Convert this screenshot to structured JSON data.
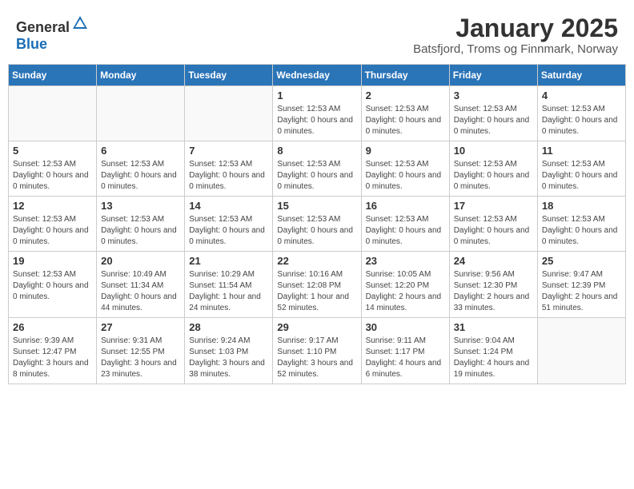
{
  "logo": {
    "general": "General",
    "blue": "Blue"
  },
  "title": "January 2025",
  "location": "Batsfjord, Troms og Finnmark, Norway",
  "headers": [
    "Sunday",
    "Monday",
    "Tuesday",
    "Wednesday",
    "Thursday",
    "Friday",
    "Saturday"
  ],
  "weeks": [
    [
      {
        "day": "",
        "info": ""
      },
      {
        "day": "",
        "info": ""
      },
      {
        "day": "",
        "info": ""
      },
      {
        "day": "1",
        "info": "Sunset: 12:53 AM\nDaylight: 0 hours and 0 minutes."
      },
      {
        "day": "2",
        "info": "Sunset: 12:53 AM\nDaylight: 0 hours and 0 minutes."
      },
      {
        "day": "3",
        "info": "Sunset: 12:53 AM\nDaylight: 0 hours and 0 minutes."
      },
      {
        "day": "4",
        "info": "Sunset: 12:53 AM\nDaylight: 0 hours and 0 minutes."
      }
    ],
    [
      {
        "day": "5",
        "info": "Sunset: 12:53 AM\nDaylight: 0 hours and 0 minutes."
      },
      {
        "day": "6",
        "info": "Sunset: 12:53 AM\nDaylight: 0 hours and 0 minutes."
      },
      {
        "day": "7",
        "info": "Sunset: 12:53 AM\nDaylight: 0 hours and 0 minutes."
      },
      {
        "day": "8",
        "info": "Sunset: 12:53 AM\nDaylight: 0 hours and 0 minutes."
      },
      {
        "day": "9",
        "info": "Sunset: 12:53 AM\nDaylight: 0 hours and 0 minutes."
      },
      {
        "day": "10",
        "info": "Sunset: 12:53 AM\nDaylight: 0 hours and 0 minutes."
      },
      {
        "day": "11",
        "info": "Sunset: 12:53 AM\nDaylight: 0 hours and 0 minutes."
      }
    ],
    [
      {
        "day": "12",
        "info": "Sunset: 12:53 AM\nDaylight: 0 hours and 0 minutes."
      },
      {
        "day": "13",
        "info": "Sunset: 12:53 AM\nDaylight: 0 hours and 0 minutes."
      },
      {
        "day": "14",
        "info": "Sunset: 12:53 AM\nDaylight: 0 hours and 0 minutes."
      },
      {
        "day": "15",
        "info": "Sunset: 12:53 AM\nDaylight: 0 hours and 0 minutes."
      },
      {
        "day": "16",
        "info": "Sunset: 12:53 AM\nDaylight: 0 hours and 0 minutes."
      },
      {
        "day": "17",
        "info": "Sunset: 12:53 AM\nDaylight: 0 hours and 0 minutes."
      },
      {
        "day": "18",
        "info": "Sunset: 12:53 AM\nDaylight: 0 hours and 0 minutes."
      }
    ],
    [
      {
        "day": "19",
        "info": "Sunset: 12:53 AM\nDaylight: 0 hours and 0 minutes."
      },
      {
        "day": "20",
        "info": "Sunrise: 10:49 AM\nSunset: 11:34 AM\nDaylight: 0 hours and 44 minutes."
      },
      {
        "day": "21",
        "info": "Sunrise: 10:29 AM\nSunset: 11:54 AM\nDaylight: 1 hour and 24 minutes."
      },
      {
        "day": "22",
        "info": "Sunrise: 10:16 AM\nSunset: 12:08 PM\nDaylight: 1 hour and 52 minutes."
      },
      {
        "day": "23",
        "info": "Sunrise: 10:05 AM\nSunset: 12:20 PM\nDaylight: 2 hours and 14 minutes."
      },
      {
        "day": "24",
        "info": "Sunrise: 9:56 AM\nSunset: 12:30 PM\nDaylight: 2 hours and 33 minutes."
      },
      {
        "day": "25",
        "info": "Sunrise: 9:47 AM\nSunset: 12:39 PM\nDaylight: 2 hours and 51 minutes."
      }
    ],
    [
      {
        "day": "26",
        "info": "Sunrise: 9:39 AM\nSunset: 12:47 PM\nDaylight: 3 hours and 8 minutes."
      },
      {
        "day": "27",
        "info": "Sunrise: 9:31 AM\nSunset: 12:55 PM\nDaylight: 3 hours and 23 minutes."
      },
      {
        "day": "28",
        "info": "Sunrise: 9:24 AM\nSunset: 1:03 PM\nDaylight: 3 hours and 38 minutes."
      },
      {
        "day": "29",
        "info": "Sunrise: 9:17 AM\nSunset: 1:10 PM\nDaylight: 3 hours and 52 minutes."
      },
      {
        "day": "30",
        "info": "Sunrise: 9:11 AM\nSunset: 1:17 PM\nDaylight: 4 hours and 6 minutes."
      },
      {
        "day": "31",
        "info": "Sunrise: 9:04 AM\nSunset: 1:24 PM\nDaylight: 4 hours and 19 minutes."
      },
      {
        "day": "",
        "info": ""
      }
    ]
  ]
}
